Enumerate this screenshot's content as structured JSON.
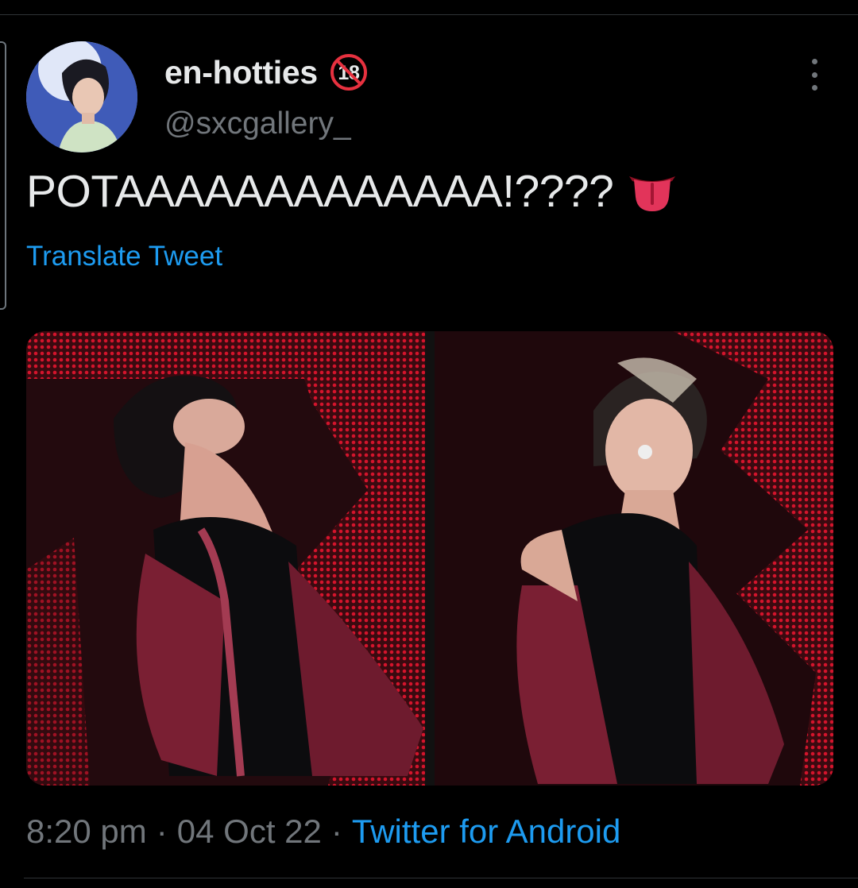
{
  "user": {
    "display_name": "en-hotties",
    "badge_text": "18",
    "handle": "@sxcgallery_"
  },
  "tweet": {
    "text": "POTAAAAAAAAAAAAA!????",
    "emoji": "tongue-emoji",
    "translate_label": "Translate Tweet",
    "media_count": 2
  },
  "meta": {
    "time": "8:20 pm",
    "separator": "·",
    "date": "04 Oct 22",
    "source": "Twitter for Android"
  },
  "colors": {
    "background": "#000000",
    "text": "#e7e9ea",
    "secondary": "#71767b",
    "link": "#1d9bf0",
    "stage_red": "#c8102e",
    "jacket": "#7a1f33"
  },
  "icons": {
    "more": "more-options-icon",
    "badge": "adult-content-18-icon"
  }
}
